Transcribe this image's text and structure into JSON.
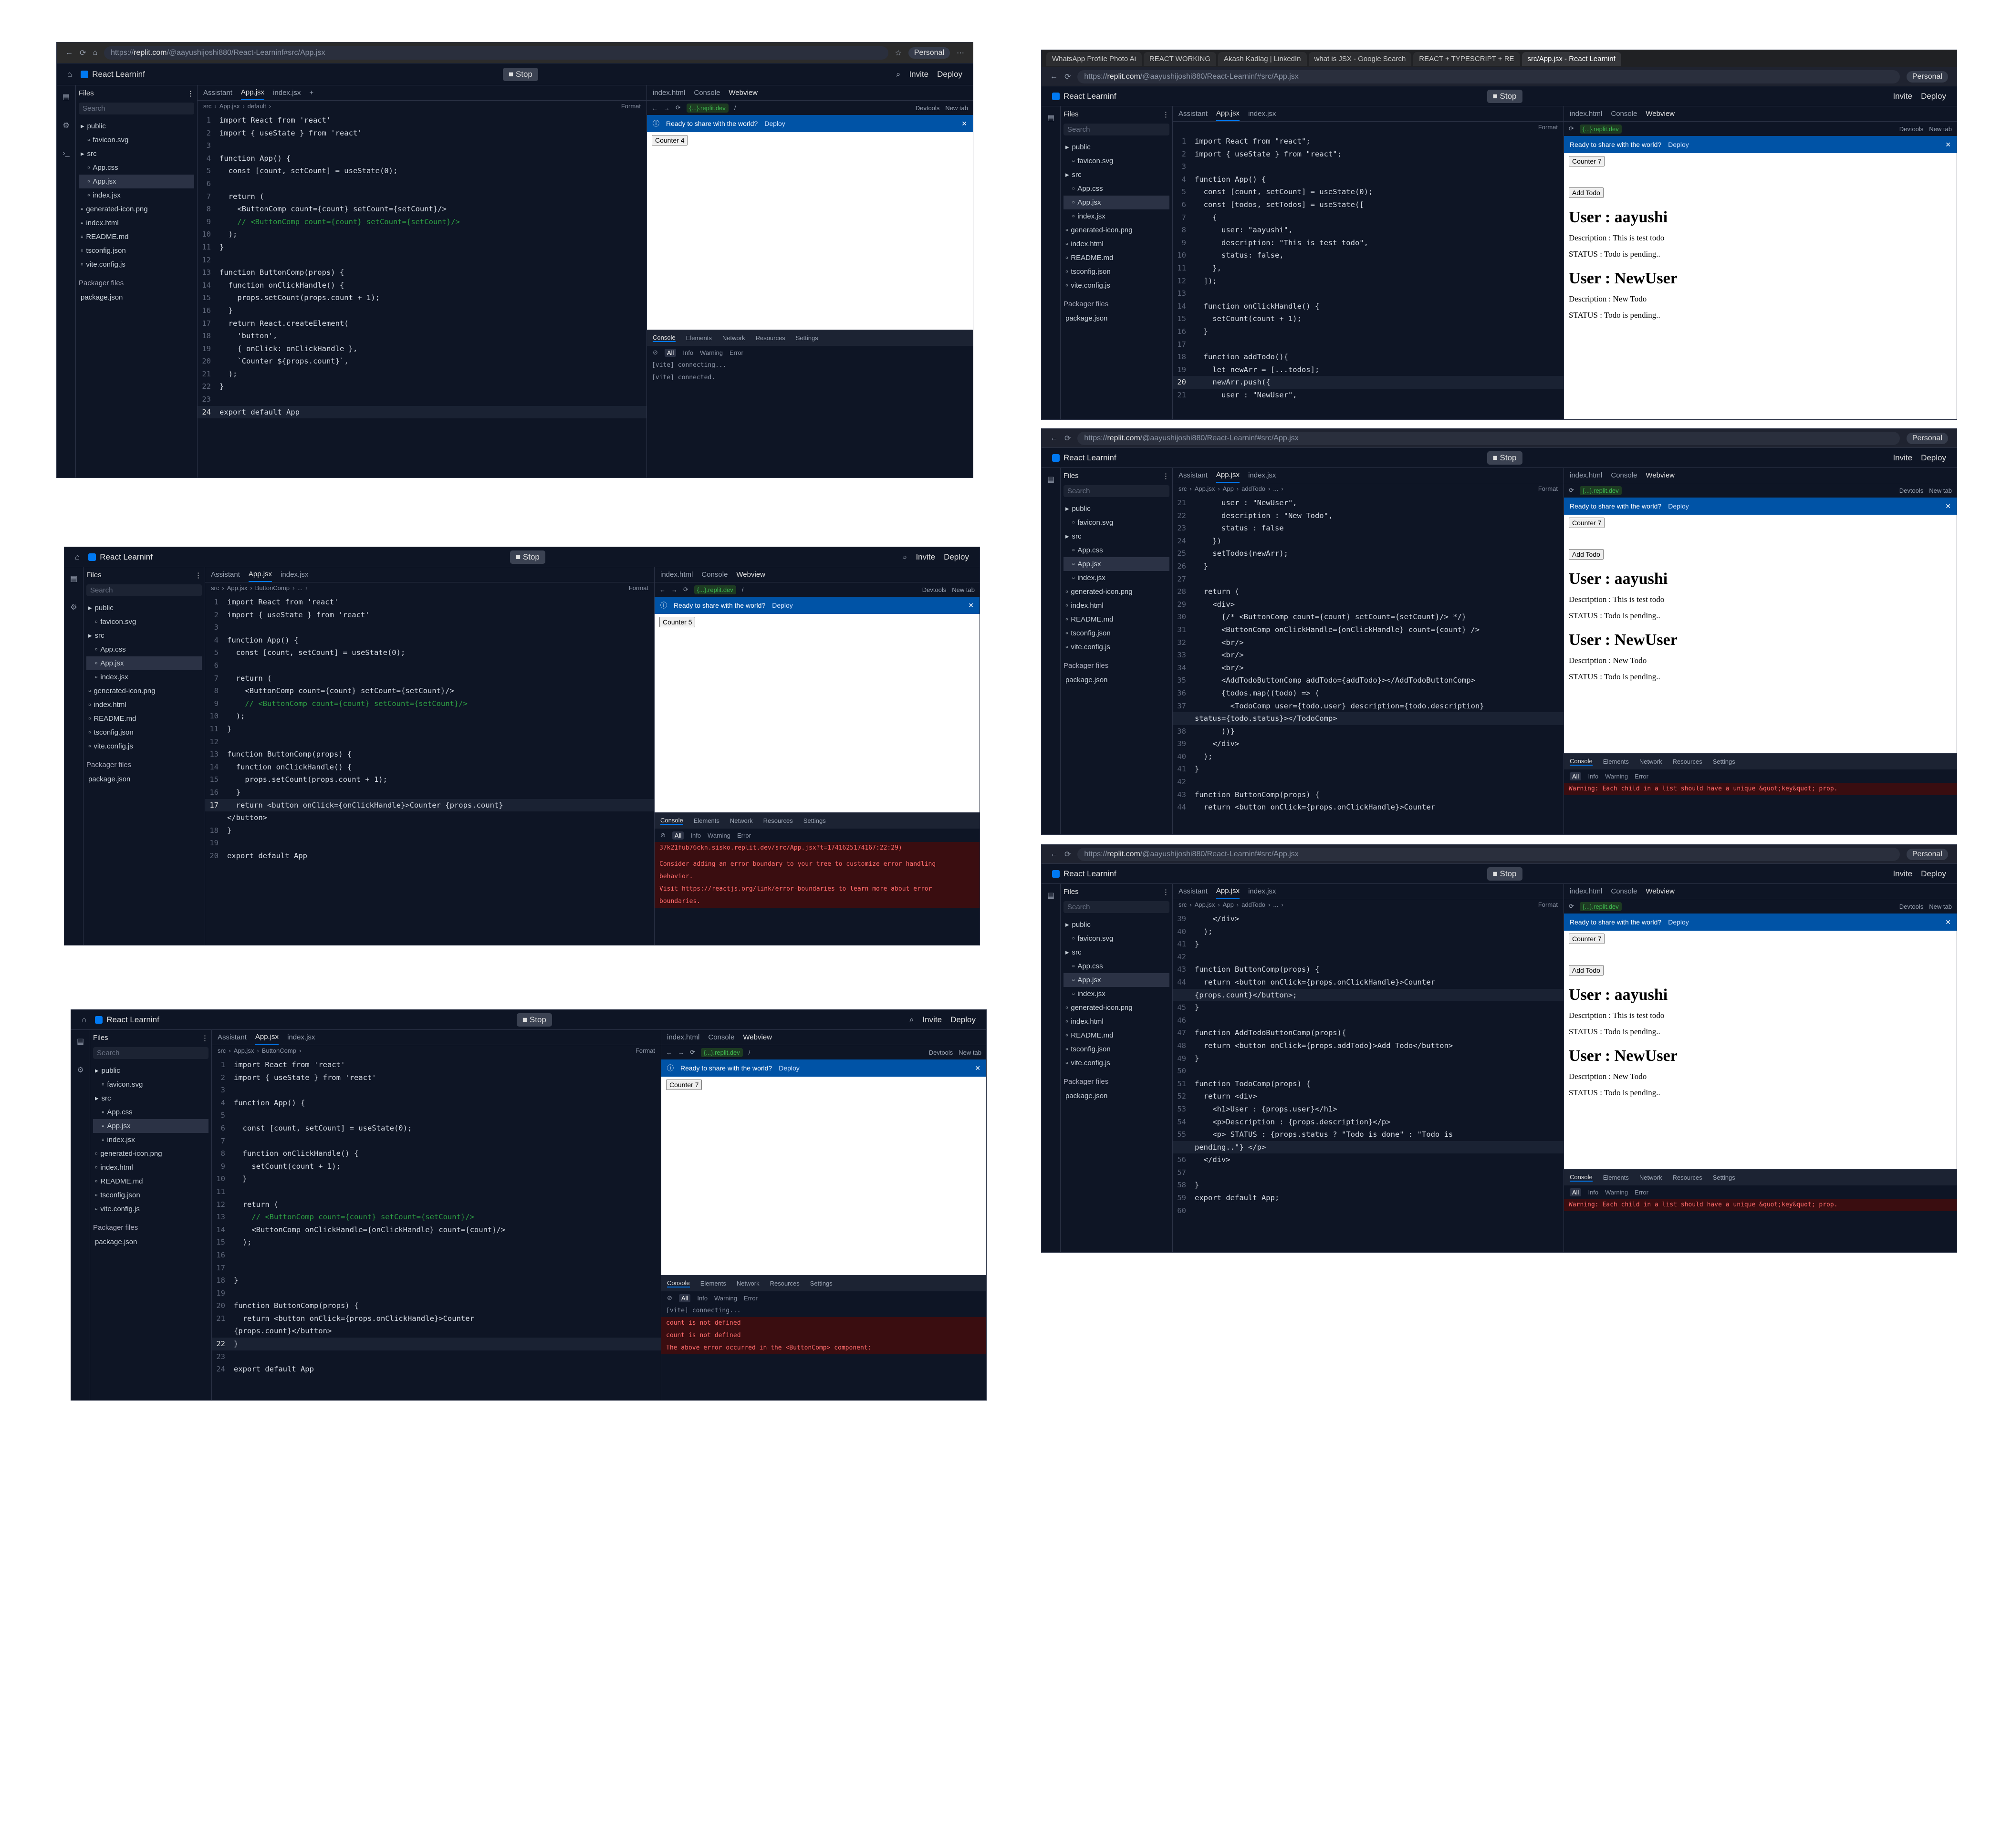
{
  "common": {
    "project": "React Learninf",
    "stop": "Stop",
    "invite": "Invite",
    "deploy": "Deploy",
    "personal": "Personal",
    "files": "Files",
    "search": "Search",
    "packager": "Packager files",
    "package_json": "package.json",
    "tab_assistant": "Assistant",
    "tab_appjsx": "App.jsx",
    "tab_indexjsx": "index.jsx",
    "tab_indexhtml": "index.html",
    "tab_console": "Console",
    "tab_webview": "Webview",
    "devtools": "Devtools",
    "newtab": "New tab",
    "replit_dev": "{...}.replit.dev",
    "slash": "/",
    "format": "Format",
    "banner": "Ready to share with the world?",
    "ctab_console": "Console",
    "ctab_elements": "Elements",
    "ctab_network": "Network",
    "ctab_resources": "Resources",
    "ctab_settings": "Settings",
    "f_all": "All",
    "f_info": "Info",
    "f_warning": "Warning",
    "f_error": "Error",
    "tree": [
      "public",
      "favicon.svg",
      "src",
      "App.css",
      "App.jsx",
      "index.jsx",
      "generated-icon.png",
      "index.html",
      "README.md",
      "tsconfig.json",
      "vite.config.js"
    ]
  },
  "s1": {
    "url_prefix": "https://",
    "url_domain": "replit.com",
    "url_rest": "/@aayushijoshi880/React-Learninf#src/App.jsx",
    "crumb": [
      "src",
      "App.jsx",
      "default"
    ],
    "counter": "Counter 4",
    "code": [
      [
        "1",
        "import React from 'react'"
      ],
      [
        "2",
        "import { useState } from 'react'"
      ],
      [
        "3",
        ""
      ],
      [
        "4",
        "function App() {"
      ],
      [
        "5",
        "  const [count, setCount] = useState(0);"
      ],
      [
        "6",
        ""
      ],
      [
        "7",
        "  return ("
      ],
      [
        "8",
        "    <ButtonComp count={count} setCount={setCount}/>"
      ],
      [
        "9",
        "    // <ButtonComp count={count} setCount={setCount}/>"
      ],
      [
        "10",
        "  );"
      ],
      [
        "11",
        "}"
      ],
      [
        "12",
        ""
      ],
      [
        "13",
        "function ButtonComp(props) {"
      ],
      [
        "14",
        "  function onClickHandle() {"
      ],
      [
        "15",
        "    props.setCount(props.count + 1);"
      ],
      [
        "16",
        "  }"
      ],
      [
        "17",
        "  return React.createElement("
      ],
      [
        "18",
        "    'button',"
      ],
      [
        "19",
        "    { onClick: onClickHandle },"
      ],
      [
        "20",
        "    `Counter ${props.count}`,"
      ],
      [
        "21",
        "  );"
      ],
      [
        "22",
        "}"
      ],
      [
        "23",
        ""
      ],
      [
        "24",
        "export default App"
      ]
    ],
    "logs": [
      "[vite] connecting...",
      "[vite] connected."
    ]
  },
  "s2": {
    "crumb": [
      "src",
      "App.jsx",
      "ButtonComp",
      "..."
    ],
    "counter": "Counter 5",
    "code": [
      [
        "1",
        "import React from 'react'"
      ],
      [
        "2",
        "import { useState } from 'react'"
      ],
      [
        "3",
        ""
      ],
      [
        "4",
        "function App() {"
      ],
      [
        "5",
        "  const [count, setCount] = useState(0);"
      ],
      [
        "6",
        ""
      ],
      [
        "7",
        "  return ("
      ],
      [
        "8",
        "    <ButtonComp count={count} setCount={setCount}/>"
      ],
      [
        "9",
        "    // <ButtonComp count={count} setCount={setCount}/>"
      ],
      [
        "10",
        "  );"
      ],
      [
        "11",
        "}"
      ],
      [
        "12",
        ""
      ],
      [
        "13",
        "function ButtonComp(props) {"
      ],
      [
        "14",
        "  function onClickHandle() {"
      ],
      [
        "15",
        "    props.setCount(props.count + 1);"
      ],
      [
        "16",
        "  }"
      ],
      [
        "17",
        "  return <button onClick={onClickHandle}>Counter {props.count}"
      ],
      [
        "",
        "</button>"
      ],
      [
        "18",
        "}"
      ],
      [
        "19",
        ""
      ],
      [
        "20",
        "export default App"
      ]
    ],
    "logs": [
      "37k21fub76ckn.sisko.replit.dev/src/App.jsx?t=1741625174167:22:29)",
      "",
      "Consider adding an error boundary to your tree to customize error handling",
      "behavior.",
      "Visit https://reactjs.org/link/error-boundaries to learn more about error",
      "boundaries."
    ]
  },
  "s3": {
    "crumb": [
      "src",
      "App.jsx",
      "ButtonComp"
    ],
    "counter": "Counter 7",
    "code": [
      [
        "1",
        "import React from 'react'"
      ],
      [
        "2",
        "import { useState } from 'react'"
      ],
      [
        "3",
        ""
      ],
      [
        "4",
        "function App() {"
      ],
      [
        "5",
        ""
      ],
      [
        "6",
        "  const [count, setCount] = useState(0);"
      ],
      [
        "7",
        ""
      ],
      [
        "8",
        "  function onClickHandle() {"
      ],
      [
        "9",
        "    setCount(count + 1);"
      ],
      [
        "10",
        "  }"
      ],
      [
        "11",
        ""
      ],
      [
        "12",
        "  return ("
      ],
      [
        "13",
        "    // <ButtonComp count={count} setCount={setCount}/>"
      ],
      [
        "14",
        "    <ButtonComp onClickHandle={onClickHandle} count={count}/>"
      ],
      [
        "15",
        "  );"
      ],
      [
        "16",
        ""
      ],
      [
        "17",
        ""
      ],
      [
        "18",
        "}"
      ],
      [
        "19",
        ""
      ],
      [
        "20",
        "function ButtonComp(props) {"
      ],
      [
        "21",
        "  return <button onClick={props.onClickHandle}>Counter"
      ],
      [
        "",
        "{props.count}</button>"
      ],
      [
        "22",
        "}"
      ],
      [
        "23",
        ""
      ],
      [
        "24",
        "export default App"
      ]
    ],
    "logs": [
      "[vite] connecting...",
      "count is not defined",
      "count is not defined",
      "The above error occurred in the <ButtonComp> component:"
    ]
  },
  "s4": {
    "tabs": [
      "WhatsApp Profile Photo Ai",
      "REACT WORKING",
      "Akash Kadlag | LinkedIn",
      "what is JSX - Google Search",
      "REACT + TYPESCRIPT + RE",
      "src/App.jsx - React Learninf"
    ],
    "crumb": [],
    "code": [
      [
        "1",
        "import React from \"react\";"
      ],
      [
        "2",
        "import { useState } from \"react\";"
      ],
      [
        "3",
        ""
      ],
      [
        "4",
        "function App() {"
      ],
      [
        "5",
        "  const [count, setCount] = useState(0);"
      ],
      [
        "6",
        "  const [todos, setTodos] = useState(["
      ],
      [
        "7",
        "    {"
      ],
      [
        "8",
        "      user: \"aayushi\","
      ],
      [
        "9",
        "      description: \"This is test todo\","
      ],
      [
        "10",
        "      status: false,"
      ],
      [
        "11",
        "    },"
      ],
      [
        "12",
        "  ]);"
      ],
      [
        "13",
        ""
      ],
      [
        "14",
        "  function onClickHandle() {"
      ],
      [
        "15",
        "    setCount(count + 1);"
      ],
      [
        "16",
        "  }"
      ],
      [
        "17",
        ""
      ],
      [
        "18",
        "  function addTodo(){"
      ],
      [
        "19",
        "    let newArr = [...todos];"
      ],
      [
        "20",
        "    newArr.push({"
      ],
      [
        "21",
        "      user : \"NewUser\","
      ]
    ]
  },
  "s5": {
    "url_domain": "replit.com",
    "url_rest": "/@aayushijoshi880/React-Learninf#src/App.jsx",
    "crumb": [
      "src",
      "App.jsx",
      "App",
      "addTodo",
      "..."
    ],
    "code": [
      [
        "21",
        "      user : \"NewUser\","
      ],
      [
        "22",
        "      description : \"New Todo\","
      ],
      [
        "23",
        "      status : false"
      ],
      [
        "24",
        "    })"
      ],
      [
        "25",
        "    setTodos(newArr);"
      ],
      [
        "26",
        "  }"
      ],
      [
        "27",
        ""
      ],
      [
        "28",
        "  return ("
      ],
      [
        "29",
        "    <div>"
      ],
      [
        "30",
        "      {/* <ButtonComp count={count} setCount={setCount}/> */}"
      ],
      [
        "31",
        "      <ButtonComp onClickHandle={onClickHandle} count={count} />"
      ],
      [
        "32",
        "      <br/>"
      ],
      [
        "33",
        "      <br/>"
      ],
      [
        "34",
        "      <br/>"
      ],
      [
        "35",
        "      <AddTodoButtonComp addTodo={addTodo}></AddTodoButtonComp>"
      ],
      [
        "36",
        "      {todos.map((todo) => ("
      ],
      [
        "37",
        "        <TodoComp user={todo.user} description={todo.description}"
      ],
      [
        "",
        "status={todo.status}></TodoComp>"
      ],
      [
        "38",
        "      ))}"
      ],
      [
        "39",
        "    </div>"
      ],
      [
        "40",
        "  );"
      ],
      [
        "41",
        "}"
      ],
      [
        "42",
        ""
      ],
      [
        "43",
        "function ButtonComp(props) {"
      ],
      [
        "44",
        "  return <button onClick={props.onClickHandle}>Counter"
      ]
    ],
    "warning": "Warning: Each child in a list should have a unique &quot;key&quot; prop."
  },
  "s6": {
    "crumb": [
      "src",
      "App.jsx",
      "App",
      "addTodo",
      "..."
    ],
    "code": [
      [
        "39",
        "    </div>"
      ],
      [
        "40",
        "  );"
      ],
      [
        "41",
        "}"
      ],
      [
        "42",
        ""
      ],
      [
        "43",
        "function ButtonComp(props) {"
      ],
      [
        "44",
        "  return <button onClick={props.onClickHandle}>Counter"
      ],
      [
        "",
        "{props.count}</button>;"
      ],
      [
        "45",
        "}"
      ],
      [
        "46",
        ""
      ],
      [
        "47",
        "function AddTodoButtonComp(props){"
      ],
      [
        "48",
        "  return <button onClick={props.addTodo}>Add Todo</button>"
      ],
      [
        "49",
        "}"
      ],
      [
        "50",
        ""
      ],
      [
        "51",
        "function TodoComp(props) {"
      ],
      [
        "52",
        "  return <div>"
      ],
      [
        "53",
        "    <h1>User : {props.user}</h1>"
      ],
      [
        "54",
        "    <p>Description : {props.description}</p>"
      ],
      [
        "55",
        "    <p> STATUS : {props.status ? \"Todo is done\" : \"Todo is"
      ],
      [
        "",
        "pending..\"} </p>"
      ],
      [
        "56",
        "  </div>"
      ],
      [
        "57",
        ""
      ],
      [
        "58",
        "}"
      ],
      [
        "59",
        "export default App;"
      ],
      [
        "60",
        ""
      ]
    ],
    "warning": "Warning: Each child in a list should have a unique &quot;key&quot; prop."
  },
  "todo_page": {
    "counter": "Counter 7",
    "add": "Add Todo",
    "items": [
      {
        "user": "User : aayushi",
        "desc": "Description : This is test todo",
        "status": "STATUS : Todo is pending.."
      },
      {
        "user": "User : NewUser",
        "desc": "Description : New Todo",
        "status": "STATUS : Todo is pending.."
      }
    ]
  }
}
